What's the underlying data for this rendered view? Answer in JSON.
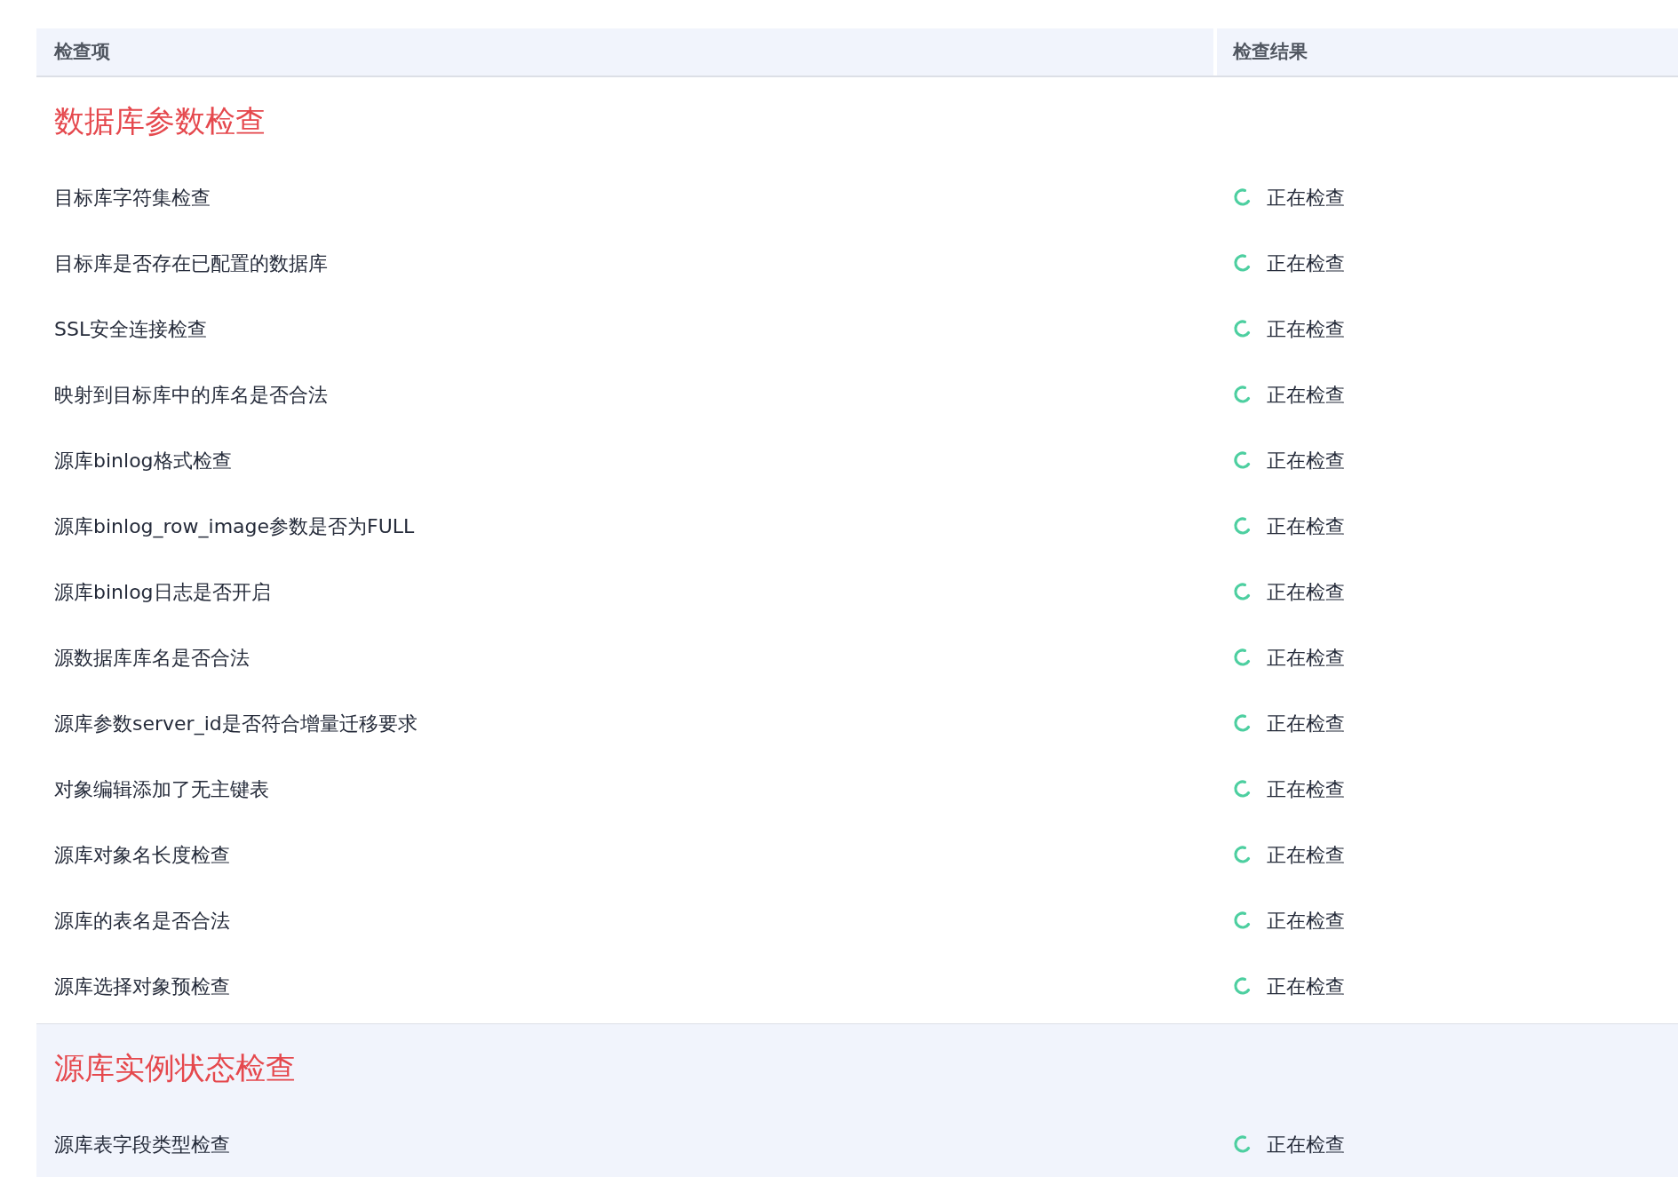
{
  "table": {
    "columns": [
      "检查项",
      "检查结果"
    ],
    "groups": [
      {
        "title": "数据库参数检查",
        "hovered": false,
        "rows": [
          {
            "item": "目标库字符集检查",
            "kind": "checking",
            "result": "正在检查"
          },
          {
            "item": "目标库是否存在已配置的数据库",
            "kind": "checking",
            "result": "正在检查"
          },
          {
            "item": "SSL安全连接检查",
            "kind": "checking",
            "result": "正在检查"
          },
          {
            "item": "映射到目标库中的库名是否合法",
            "kind": "checking",
            "result": "正在检查"
          },
          {
            "item": "源库binlog格式检查",
            "kind": "checking",
            "result": "正在检查"
          },
          {
            "item": "源库binlog_row_image参数是否为FULL",
            "kind": "checking",
            "result": "正在检查"
          },
          {
            "item": "源库binlog日志是否开启",
            "kind": "checking",
            "result": "正在检查"
          },
          {
            "item": "源数据库库名是否合法",
            "kind": "checking",
            "result": "正在检查"
          },
          {
            "item": "源库参数server_id是否符合增量迁移要求",
            "kind": "checking",
            "result": "正在检查"
          },
          {
            "item": "对象编辑添加了无主键表",
            "kind": "checking",
            "result": "正在检查"
          },
          {
            "item": "源库对象名长度检查",
            "kind": "checking",
            "result": "正在检查"
          },
          {
            "item": "源库的表名是否合法",
            "kind": "checking",
            "result": "正在检查"
          },
          {
            "item": "源库选择对象预检查",
            "kind": "checking",
            "result": "正在检查"
          }
        ]
      },
      {
        "title": "源库实例状态检查",
        "hovered": true,
        "rows": [
          {
            "item": "源库表字段类型检查",
            "kind": "checking",
            "result": "正在检查"
          }
        ]
      }
    ]
  }
}
